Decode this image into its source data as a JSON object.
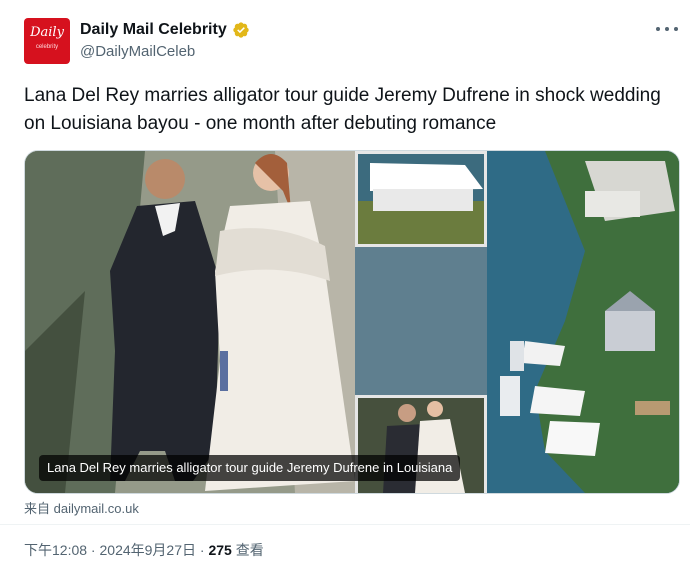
{
  "account": {
    "display_name": "Daily Mail Celebrity",
    "handle": "@DailyMailCeleb",
    "avatar_text": "Daily",
    "avatar_subtext": "celebrity",
    "avatar_color": "#d6111e",
    "verified_badge_color": "#e2b719"
  },
  "tweet": {
    "text": "Lana Del Rey marries alligator tour guide Jeremy Dufrene in shock wedding on Louisiana bayou - one month after debuting romance"
  },
  "media": {
    "caption": "Lana Del Rey marries alligator tour guide Jeremy Dufrene in Louisiana",
    "source": "来自 dailymail.co.uk"
  },
  "meta": {
    "time": "下午12:08",
    "separator": " · ",
    "date": "2024年9月27日",
    "views_count": "275",
    "views_label": " 查看"
  },
  "icons": {
    "more": "more-options-icon",
    "verified": "verified-badge-icon"
  }
}
